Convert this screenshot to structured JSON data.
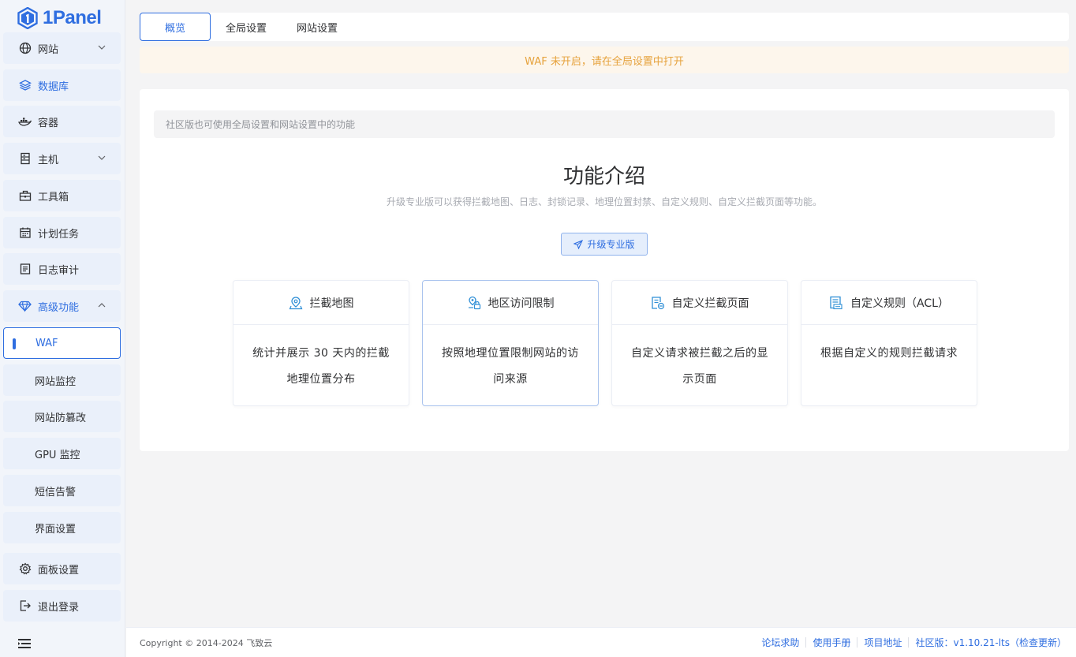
{
  "app": {
    "logo_text": "1Panel"
  },
  "sidebar": {
    "items": [
      {
        "label": "网站",
        "icon": "globe-icon"
      },
      {
        "label": "数据库",
        "icon": "database-icon"
      },
      {
        "label": "容器",
        "icon": "docker-icon"
      },
      {
        "label": "主机",
        "icon": "host-icon"
      },
      {
        "label": "工具箱",
        "icon": "toolbox-icon"
      },
      {
        "label": "计划任务",
        "icon": "calendar-icon"
      },
      {
        "label": "日志审计",
        "icon": "log-icon"
      },
      {
        "label": "高级功能",
        "icon": "diamond-icon"
      }
    ],
    "sub_items": [
      {
        "label": "WAF"
      },
      {
        "label": "网站监控"
      },
      {
        "label": "网站防篡改"
      },
      {
        "label": "GPU 监控"
      },
      {
        "label": "短信告警"
      },
      {
        "label": "界面设置"
      }
    ],
    "bottom_items": [
      {
        "label": "面板设置",
        "icon": "gear-icon"
      },
      {
        "label": "退出登录",
        "icon": "logout-icon"
      }
    ]
  },
  "tabs": [
    {
      "label": "概览"
    },
    {
      "label": "全局设置"
    },
    {
      "label": "网站设置"
    }
  ],
  "warning": "WAF 未开启，请在全局设置中打开",
  "main": {
    "info": "社区版也可使用全局设置和网站设置中的功能",
    "intro_title": "功能介绍",
    "intro_desc": "升级专业版可以获得拦截地图、日志、封锁记录、地理位置封禁、自定义规则、自定义拦截页面等功能。",
    "upgrade_label": "升级专业版",
    "features": [
      {
        "title": "拦截地图",
        "desc": "统计并展示 30 天内的拦截地理位置分布",
        "icon": "location-pin-icon"
      },
      {
        "title": "地区访问限制",
        "desc": "按照地理位置限制网站的访问来源",
        "icon": "region-lock-icon"
      },
      {
        "title": "自定义拦截页面",
        "desc": "自定义请求被拦截之后的显示页面",
        "icon": "custom-page-icon"
      },
      {
        "title": "自定义规则（ACL）",
        "desc": "根据自定义的规则拦截请求",
        "icon": "rule-icon"
      }
    ]
  },
  "footer": {
    "copyright": "Copyright © 2014-2024 飞致云",
    "links": [
      "论坛求助",
      "使用手册",
      "项目地址"
    ],
    "version": "社区版：v1.10.21-lts（检查更新）"
  },
  "colors": {
    "accent": "#2f6ee0",
    "warning": "#e6a23c",
    "sidebar_bg": "#f2f5fa"
  }
}
